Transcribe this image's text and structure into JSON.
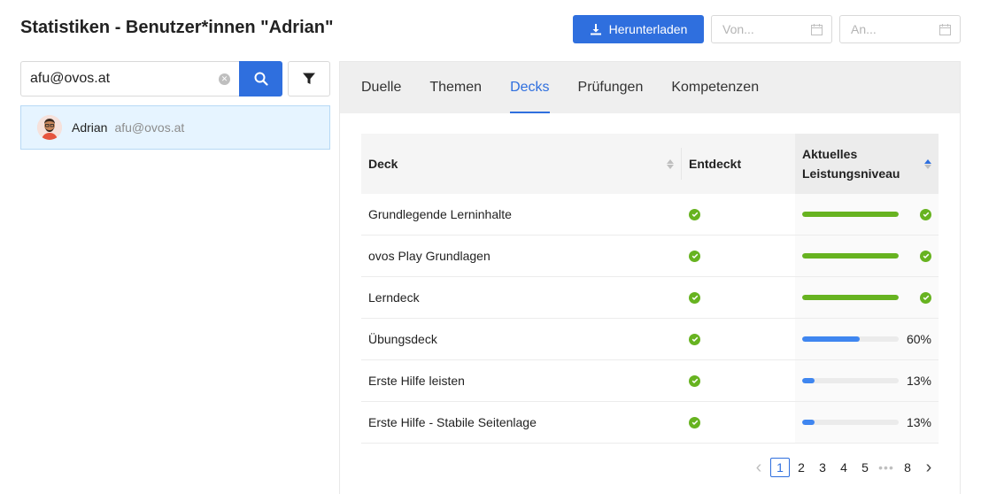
{
  "header": {
    "title": "Statistiken - Benutzer*innen \"Adrian\"",
    "download_label": "Herunterladen",
    "date_from_placeholder": "Von...",
    "date_to_placeholder": "An..."
  },
  "search": {
    "value": "afu@ovos.at"
  },
  "user_list": [
    {
      "name": "Adrian",
      "email": "afu@ovos.at"
    }
  ],
  "tabs": [
    {
      "label": "Duelle",
      "active": false
    },
    {
      "label": "Themen",
      "active": false
    },
    {
      "label": "Decks",
      "active": true
    },
    {
      "label": "Prüfungen",
      "active": false
    },
    {
      "label": "Kompetenzen",
      "active": false
    }
  ],
  "table": {
    "columns": {
      "deck": "Deck",
      "entdeckt": "Entdeckt",
      "level": "Aktuelles Leistungsniveau"
    },
    "rows": [
      {
        "deck": "Grundlegende Lerninhalte",
        "entdeckt": true,
        "progress": 100,
        "label": "",
        "complete": true
      },
      {
        "deck": "ovos Play Grundlagen",
        "entdeckt": true,
        "progress": 100,
        "label": "",
        "complete": true
      },
      {
        "deck": "Lerndeck",
        "entdeckt": true,
        "progress": 100,
        "label": "",
        "complete": true
      },
      {
        "deck": "Übungsdeck",
        "entdeckt": true,
        "progress": 60,
        "label": "60%",
        "complete": false
      },
      {
        "deck": "Erste Hilfe leisten",
        "entdeckt": true,
        "progress": 13,
        "label": "13%",
        "complete": false
      },
      {
        "deck": "Erste Hilfe - Stabile Seitenlage",
        "entdeckt": true,
        "progress": 13,
        "label": "13%",
        "complete": false
      }
    ]
  },
  "pagination": {
    "pages": [
      "1",
      "2",
      "3",
      "4",
      "5",
      "•••",
      "8"
    ],
    "current": "1"
  },
  "colors": {
    "primary": "#2f6fde",
    "success": "#67b320",
    "progress_blue": "#3f86f0"
  }
}
